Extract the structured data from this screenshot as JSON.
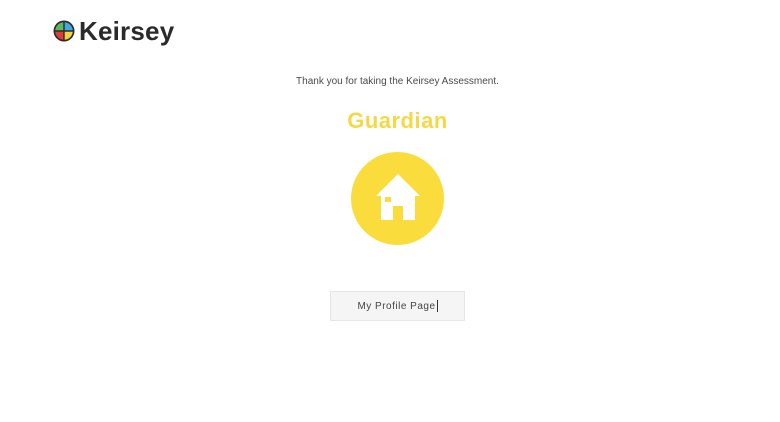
{
  "header": {
    "brand_name": "Keirsey",
    "logo_icon": "color-wheel-logo"
  },
  "result": {
    "thanks_message": "Thank you for taking the Keirsey Assessment.",
    "type_name": "Guardian",
    "type_icon": "house-icon",
    "accent_color": "#fadd3d"
  },
  "actions": {
    "profile_button_label": "My Profile Page"
  }
}
